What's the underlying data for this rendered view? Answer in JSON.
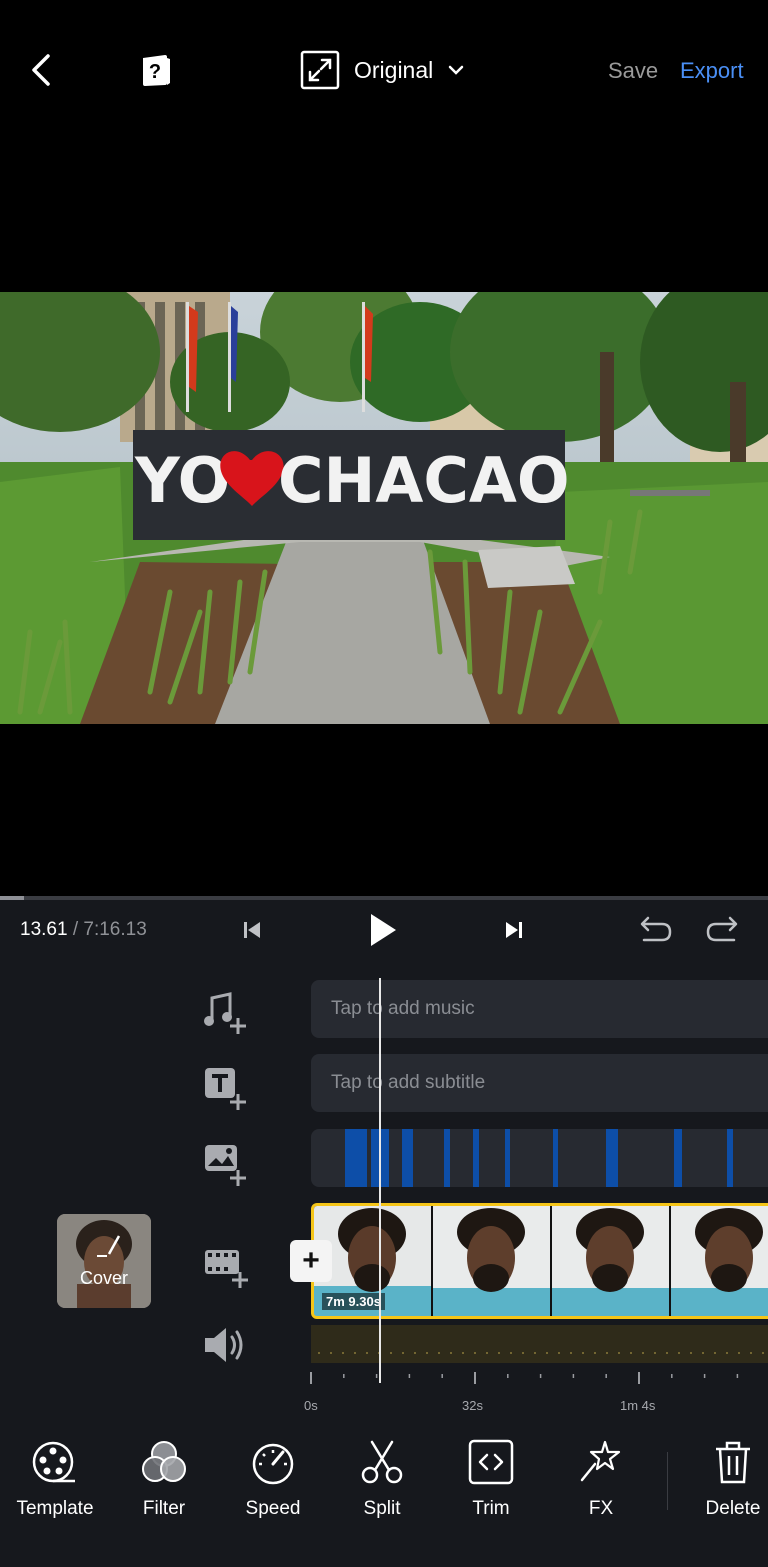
{
  "header": {
    "aspect_label": "Original",
    "save_label": "Save",
    "export_label": "Export"
  },
  "preview": {
    "sign_text_left": "YO",
    "sign_text_right": "CHACAO"
  },
  "playback": {
    "current_time": "13.61",
    "separator": " / ",
    "total_time": "7:16.13",
    "progress_fraction": 0.031
  },
  "tracks": {
    "music_placeholder": "Tap to add music",
    "subtitle_placeholder": "Tap to add subtitle"
  },
  "clip": {
    "duration_label": "7m 9.30s",
    "cover_label": "Cover"
  },
  "ruler": {
    "labels": [
      "0s",
      "32s",
      "1m 4s"
    ]
  },
  "toolbar": {
    "items": [
      {
        "label": "Template",
        "icon": "template-icon"
      },
      {
        "label": "Filter",
        "icon": "filter-icon"
      },
      {
        "label": "Speed",
        "icon": "speed-icon"
      },
      {
        "label": "Split",
        "icon": "scissors-icon"
      },
      {
        "label": "Trim",
        "icon": "trim-icon"
      },
      {
        "label": "FX",
        "icon": "fx-icon"
      },
      {
        "label": "Delete",
        "icon": "trash-icon"
      }
    ]
  },
  "colors": {
    "accent": "#4a8ff5",
    "clip_border": "#f5c518",
    "marker": "#0d4ea8",
    "panel_bg": "#16181d"
  }
}
